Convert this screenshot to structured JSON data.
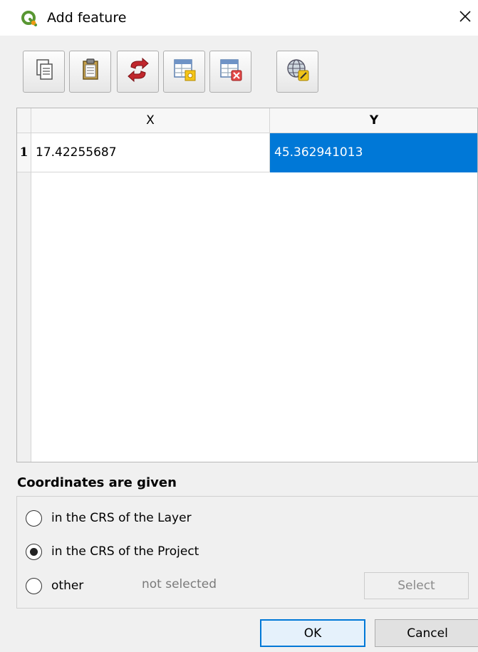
{
  "window": {
    "title": "Add feature",
    "app_icon": "qgis-logo-icon",
    "close_icon": "close-icon"
  },
  "toolbar": {
    "buttons": [
      {
        "icon": "copy-icon"
      },
      {
        "icon": "paste-icon"
      },
      {
        "icon": "swap-xy-icon"
      },
      {
        "icon": "add-row-icon"
      },
      {
        "icon": "delete-row-icon"
      },
      {
        "icon": "digitize-globe-icon"
      }
    ]
  },
  "table": {
    "columns": [
      "X",
      "Y"
    ],
    "rows": [
      {
        "index": "1",
        "x": "17.42255687",
        "y": "45.362941013"
      }
    ]
  },
  "crs": {
    "group_title": "Coordinates are given",
    "options": [
      {
        "label": "in the CRS of the Layer",
        "checked": false
      },
      {
        "label": "in the CRS of the Project",
        "checked": true
      },
      {
        "label": "other",
        "checked": false
      }
    ],
    "other_status": "not selected",
    "select_label": "Select"
  },
  "buttons": {
    "ok": "OK",
    "cancel": "Cancel"
  },
  "colors": {
    "selection": "#0078d7",
    "qgis_green": "#589632",
    "qgis_yellow": "#ee9b13"
  }
}
